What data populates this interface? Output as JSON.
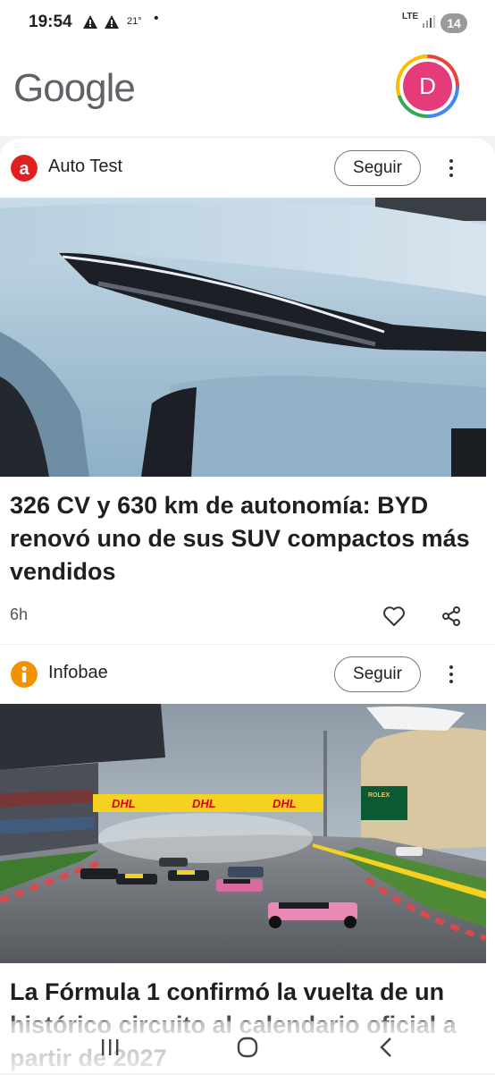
{
  "status_bar": {
    "time": "19:54",
    "warning_icon": "alert-triangle-icon",
    "temperature": "21°",
    "dot": "•",
    "network": "LTE",
    "battery": "14"
  },
  "header": {
    "logo": "Google",
    "avatar_letter": "D",
    "avatar_color": "#e63b7a"
  },
  "cards": [
    {
      "source": "Auto Test",
      "source_icon": "auto-test-logo-icon",
      "source_color": "#e0201f",
      "follow_label": "Seguir",
      "headline": "326 CV y 630 km de autonomía: BYD renovó uno de sus SUV compactos más vendidos",
      "time_ago": "6h",
      "image": "light blue BYD SUV headlight close-up"
    },
    {
      "source": "Infobae",
      "source_icon": "infobae-logo-icon",
      "source_color": "#f39200",
      "follow_label": "Seguir",
      "headline": "La Fórmula 1 confirmó la vuelta de un histórico circuito al calendario oficial a partir de 2027",
      "image": "Formula 1 race start on wet track",
      "banner_text": "DHL"
    }
  ],
  "nav": {
    "recents_icon": "recent-apps-icon",
    "home_icon": "home-icon",
    "back_icon": "back-icon"
  }
}
